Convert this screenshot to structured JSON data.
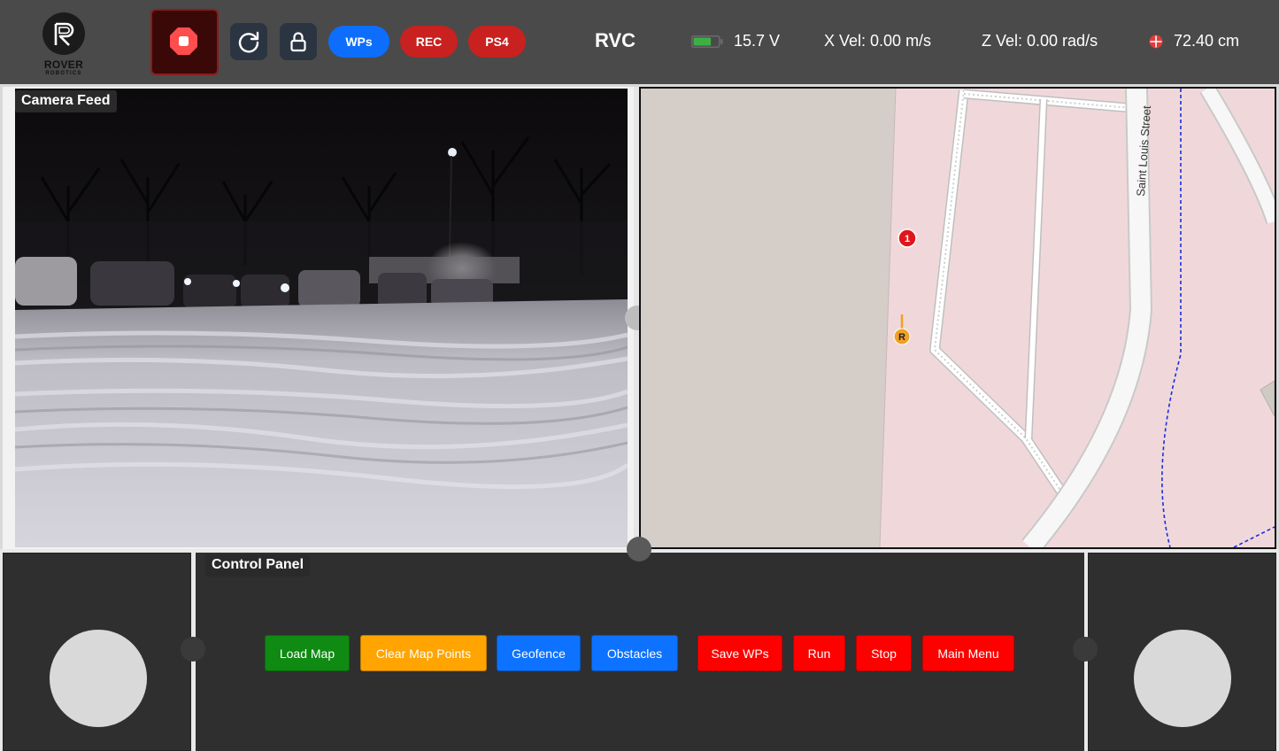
{
  "header": {
    "logo": {
      "brand": "ROVER",
      "sub": "ROBOTICS",
      "icon": "rover-logo-icon"
    },
    "emergency_stop": {
      "icon": "stop-octagon-icon",
      "color": "#ff4d4d"
    },
    "refresh": {
      "icon": "refresh-icon"
    },
    "lock": {
      "icon": "lock-icon"
    },
    "pills": {
      "wps": "WPs",
      "rec": "REC",
      "ps4": "PS4"
    },
    "title": "RVC",
    "battery": {
      "icon": "battery-icon",
      "value": "15.7 V",
      "level": 0.7,
      "color": "#3cb043"
    },
    "x_vel": "X Vel: 0.00 m/s",
    "z_vel": "Z Vel: 0.00 rad/s",
    "distance": {
      "icon": "crosshair-icon",
      "value": "72.40 cm"
    }
  },
  "camera": {
    "label": "Camera Feed"
  },
  "map": {
    "street_label": "Saint Louis Street",
    "waypoint_marker": "1",
    "rover_marker": "R",
    "colors": {
      "land": "#d5cdc8",
      "residential": "#f0d8da",
      "road": "#f7f7f7",
      "waypoint": "#e0161b",
      "rover": "#f2a125",
      "path": "#1a2fe0"
    }
  },
  "control_panel": {
    "label": "Control Panel",
    "buttons": [
      {
        "label": "Load Map",
        "color": "#0f8a12"
      },
      {
        "label": "Clear Map Points",
        "color": "#ffa400"
      },
      {
        "label": "Geofence",
        "color": "#0d72ff"
      },
      {
        "label": "Obstacles",
        "color": "#0d72ff"
      },
      {
        "label": "Save WPs",
        "color": "#ff0000"
      },
      {
        "label": "Run",
        "color": "#ff0000"
      },
      {
        "label": "Stop",
        "color": "#ff0000"
      },
      {
        "label": "Main Menu",
        "color": "#ff0000"
      }
    ]
  },
  "joysticks": {
    "left": "left-joystick",
    "right": "right-joystick"
  }
}
